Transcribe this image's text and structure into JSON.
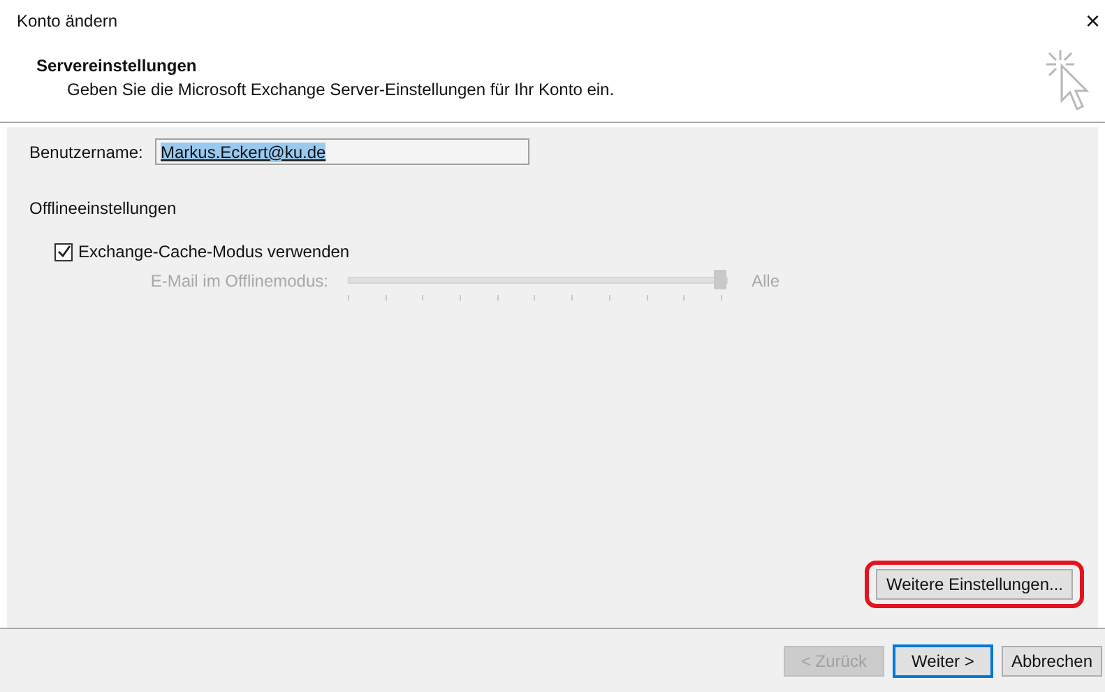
{
  "window": {
    "title": "Konto ändern",
    "close": "×"
  },
  "header": {
    "title": "Servereinstellungen",
    "subtitle": "Geben Sie die Microsoft Exchange Server-Einstellungen für Ihr Konto ein."
  },
  "username": {
    "label": "Benutzername:",
    "value": "Markus.Eckert@ku.de",
    "text_selected": true
  },
  "offline": {
    "heading": "Offlineeinstellungen",
    "cache_mode": {
      "label": "Exchange-Cache-Modus verwenden",
      "checked": true
    },
    "slider": {
      "label": "E-Mail im Offlinemodus:",
      "level": 1,
      "reading": "Alle",
      "disabled": true
    }
  },
  "more_settings": {
    "label": "Weitere Einstellungen...",
    "highlighted": true
  },
  "buttons": [
    {
      "label": "< Zurück",
      "disabled": true,
      "default": false
    },
    {
      "label": "Weiter >",
      "disabled": false,
      "default": true
    },
    {
      "label": "Abbrechen",
      "disabled": false,
      "default": false
    }
  ]
}
